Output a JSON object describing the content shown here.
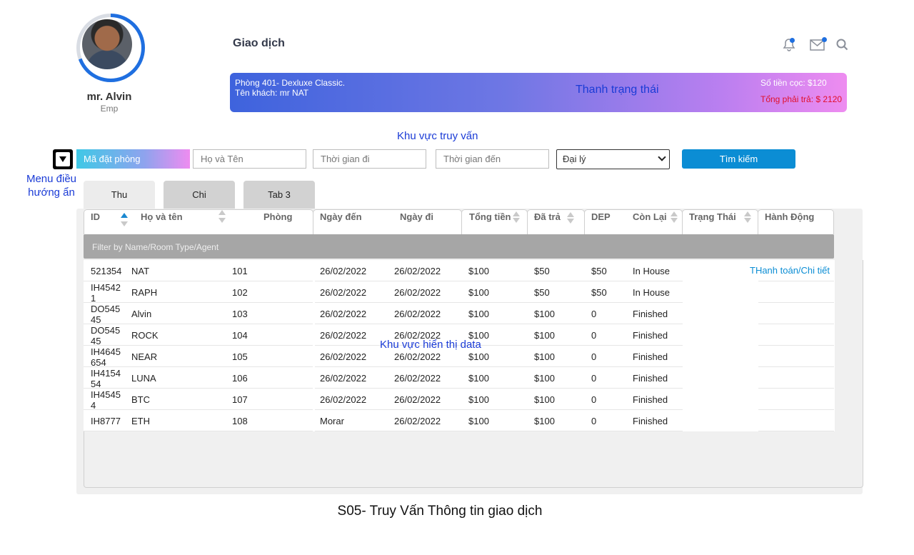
{
  "profile": {
    "name": "mr. Alvin",
    "role": "Emp"
  },
  "page_title": "Giao dịch",
  "status_bar": {
    "room": "Phòng 401- Dexluxe Classic.",
    "guest": "Tên khách: mr NAT",
    "label": "Thanh trạng thái",
    "deposit": "Số tiền cọc: $120",
    "total": "Tổng phải trả: $ 2120"
  },
  "query_label": "Khu vực truy vấn",
  "menu_label": "Menu điều hướng ẩn",
  "filters": {
    "booking_code": "Mã đặt phòng",
    "name_placeholder": "Họ và Tên",
    "depart_placeholder": "Thời gian đi",
    "arrive_placeholder": "Thời gian đến",
    "agent_select": "Đại lý",
    "search_button": "Tìm kiếm"
  },
  "tabs": [
    {
      "label": "Thu"
    },
    {
      "label": "Chi"
    },
    {
      "label": "Tab 3"
    }
  ],
  "table": {
    "headers": [
      "ID",
      "Họ và tên",
      "Phòng",
      "Ngày đến",
      "Ngày đi",
      "Tổng tiền",
      "Đã trả",
      "DEP",
      "Còn Lại",
      "Trạng Thái",
      "Hành Động"
    ],
    "filter_placeholder": "Filter by Name/Room Type/Agent",
    "rows": [
      {
        "id": "521354",
        "name": "NAT",
        "room": "101",
        "arrive": "26/02/2022",
        "depart": "26/02/2022",
        "total": "$100",
        "paid": "$50",
        "dep": "$50",
        "status": "In House"
      },
      {
        "id": "IH4542 1",
        "name": "RAPH",
        "room": "102",
        "arrive": "26/02/2022",
        "depart": "26/02/2022",
        "total": "$100",
        "paid": "$50",
        "dep": "$50",
        "status": "In House"
      },
      {
        "id": "DO545 45",
        "name": "Alvin",
        "room": "103",
        "arrive": "26/02/2022",
        "depart": "26/02/2022",
        "total": "$100",
        "paid": "$100",
        "dep": "0",
        "status": "Finished"
      },
      {
        "id": "DO545 45",
        "name": "ROCK",
        "room": "104",
        "arrive": "26/02/2022",
        "depart": "26/02/2022",
        "total": "$100",
        "paid": "$100",
        "dep": "0",
        "status": "Finished"
      },
      {
        "id": "IH4645 654",
        "name": "NEAR",
        "room": "105",
        "arrive": "26/02/2022",
        "depart": "26/02/2022",
        "total": "$100",
        "paid": "$100",
        "dep": "0",
        "status": "Finished"
      },
      {
        "id": "IH4154 54",
        "name": "LUNA",
        "room": "106",
        "arrive": "26/02/2022",
        "depart": "26/02/2022",
        "total": "$100",
        "paid": "$100",
        "dep": "0",
        "status": "Finished"
      },
      {
        "id": "IH4545 4",
        "name": "BTC",
        "room": "107",
        "arrive": "26/02/2022",
        "depart": "26/02/2022",
        "total": "$100",
        "paid": "$100",
        "dep": "0",
        "status": "Finished"
      },
      {
        "id": "IH8777",
        "name": "ETH",
        "room": "108",
        "arrive": "Morar",
        "depart": "26/02/2022",
        "total": "$100",
        "paid": "$100",
        "dep": "0",
        "status": "Finished"
      }
    ],
    "action_link": "THanh toán/Chi tiết"
  },
  "data_area_label": "Khu vực hiển thị data",
  "caption": "S05- Truy Vấn Thông tin giao dịch",
  "colors": {
    "accent": "#0b8dd4",
    "annotation": "#1a3bd6",
    "total_red": "#e0102c"
  }
}
